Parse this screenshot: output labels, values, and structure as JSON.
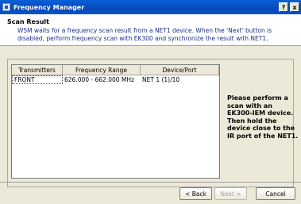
{
  "window": {
    "title": "Frequency Manager",
    "help_label": "?",
    "close_label": "x"
  },
  "header": {
    "title": "Scan Result",
    "description": "WSM waits for a frequency scan result from a NET1 device. When the 'Next' button is disabled, perform frequency scan with EK300 and synchronize the result with NET1."
  },
  "table": {
    "columns": [
      "Transmitters",
      "Frequency Range",
      "Device/Port"
    ],
    "rows": [
      [
        "FRONT",
        "626.000 - 662.000 MHz",
        "NET 1 (1)/10"
      ]
    ]
  },
  "info_text": "Please perform a scan with an EK300-IEM device. Then hold the device close to the IR port of the NET1.",
  "buttons": {
    "back": "< Back",
    "next": "Next >",
    "cancel": "Cancel"
  }
}
